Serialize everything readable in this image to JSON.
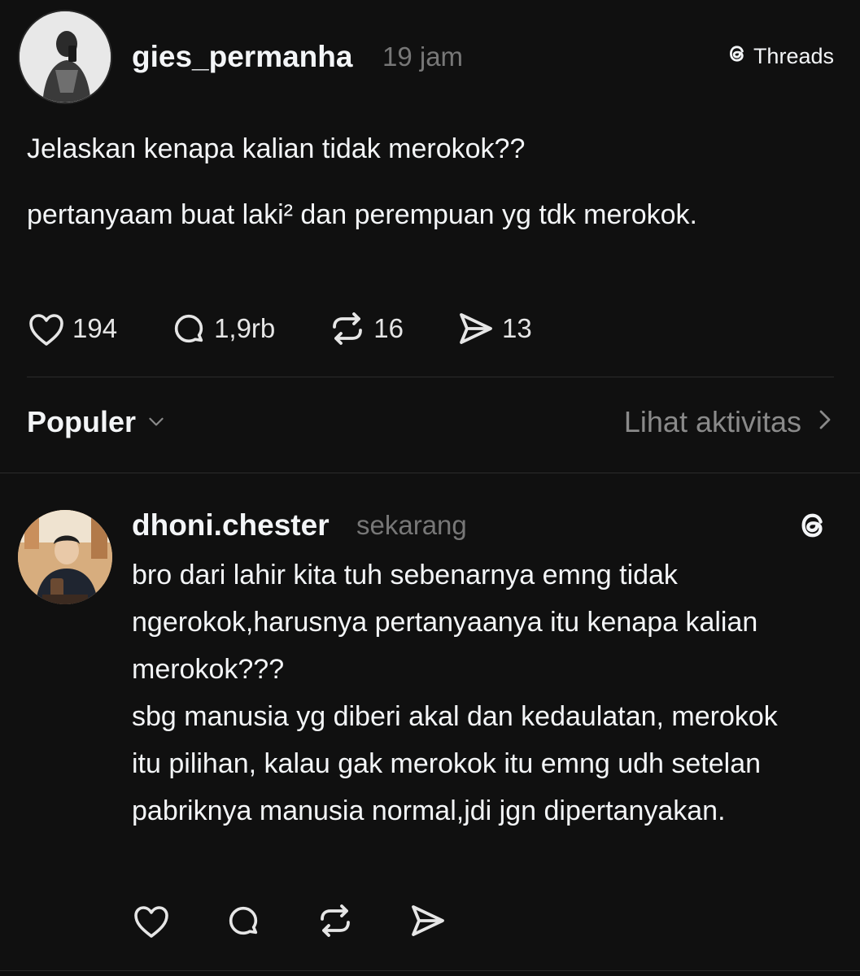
{
  "post": {
    "username": "gies_permanha",
    "timestamp": "19 jam",
    "source_label": "Threads",
    "paragraphs": [
      "Jelaskan kenapa kalian tidak merokok??",
      "pertanyaam buat laki² dan perempuan yg tdk merokok."
    ],
    "stats": {
      "likes": "194",
      "replies": "1,9rb",
      "reposts": "16",
      "shares": "13"
    }
  },
  "sort": {
    "label": "Populer",
    "activity_link": "Lihat aktivitas"
  },
  "reply": {
    "username": "dhoni.chester",
    "timestamp": "sekarang",
    "paragraphs": [
      "bro dari lahir kita tuh sebenarnya emng tidak ngerokok,harusnya pertanyaanya itu kenapa kalian merokok???",
      "sbg manusia yg diberi akal dan kedaulatan, merokok itu pilihan, kalau gak merokok itu emng udh setelan pabriknya manusia normal,jdi jgn dipertanyakan."
    ]
  },
  "colors": {
    "background": "#101010",
    "text": "#f3f5f7",
    "muted": "#777777"
  }
}
